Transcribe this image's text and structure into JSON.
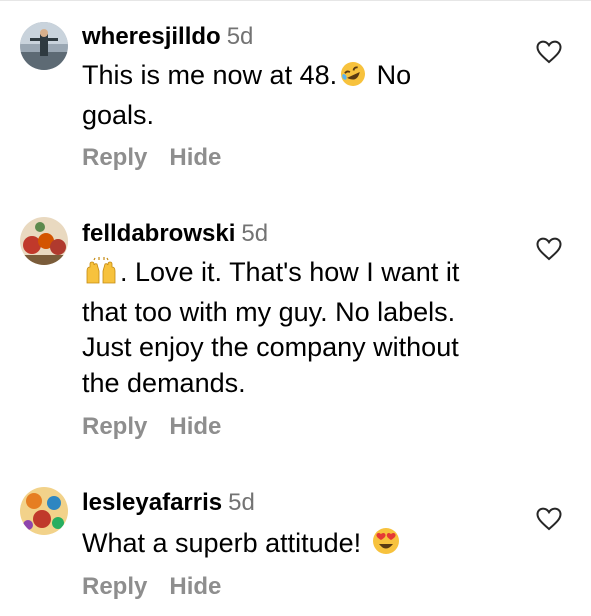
{
  "comments": [
    {
      "username": "wheresjilldo",
      "time": "5d",
      "lines": [
        "This is me now at 48.",
        "No",
        "goals."
      ],
      "reply_label": "Reply",
      "hide_label": "Hide",
      "emoji": "rolling-on-floor-laughing-emoji"
    },
    {
      "username": "felldabrowski",
      "time": "5d",
      "lines": [
        ". Love it.  That's how I want it",
        "that too with my guy.  No labels.",
        "Just enjoy the company without",
        "the demands."
      ],
      "reply_label": "Reply",
      "hide_label": "Hide",
      "emoji": "raising-hands-emoji"
    },
    {
      "username": "lesleyafarris",
      "time": "5d",
      "lines": [
        "What a superb attitude!"
      ],
      "reply_label": "Reply",
      "hide_label": "Hide",
      "emoji": "heart-eyes-emoji"
    }
  ],
  "colors": {
    "username": "#000000",
    "meta": "#737373",
    "actions": "#8e8e8e",
    "heart_outline": "#262626"
  },
  "icons": {
    "like": "heart-outline-icon"
  }
}
